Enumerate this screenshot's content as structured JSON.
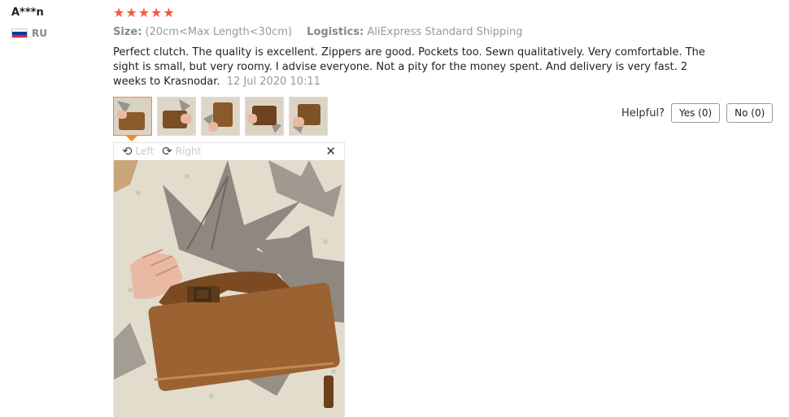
{
  "reviewer": {
    "name": "A***n",
    "country": "RU"
  },
  "rating": {
    "stars": 5,
    "max": 5
  },
  "meta": {
    "size_label": "Size:",
    "size_value": "(20cm<Max Length<30cm)",
    "logistics_label": "Logistics:",
    "logistics_value": "AliExpress Standard Shipping"
  },
  "review": {
    "text": "Perfect clutch. The quality is excellent. Zippers are good. Pockets too. Sewn qualitatively. Very comfortable. The sight is small, but very roomy. I advise everyone. Not a pity for the money spent. And delivery is very fast. 2 weeks to Krasnodar.",
    "date": "12 Jul 2020 10:11"
  },
  "thumbnails": {
    "count": 5,
    "selected_index": 0
  },
  "helpful": {
    "label": "Helpful?",
    "yes": "Yes (0)",
    "no": "No (0)"
  },
  "viewer": {
    "left_label": "Left",
    "right_label": "Right",
    "close_icon": "close-icon"
  },
  "colors": {
    "star": "#f25c3c",
    "selected_border": "#f08a2f",
    "muted_text": "#999999"
  }
}
